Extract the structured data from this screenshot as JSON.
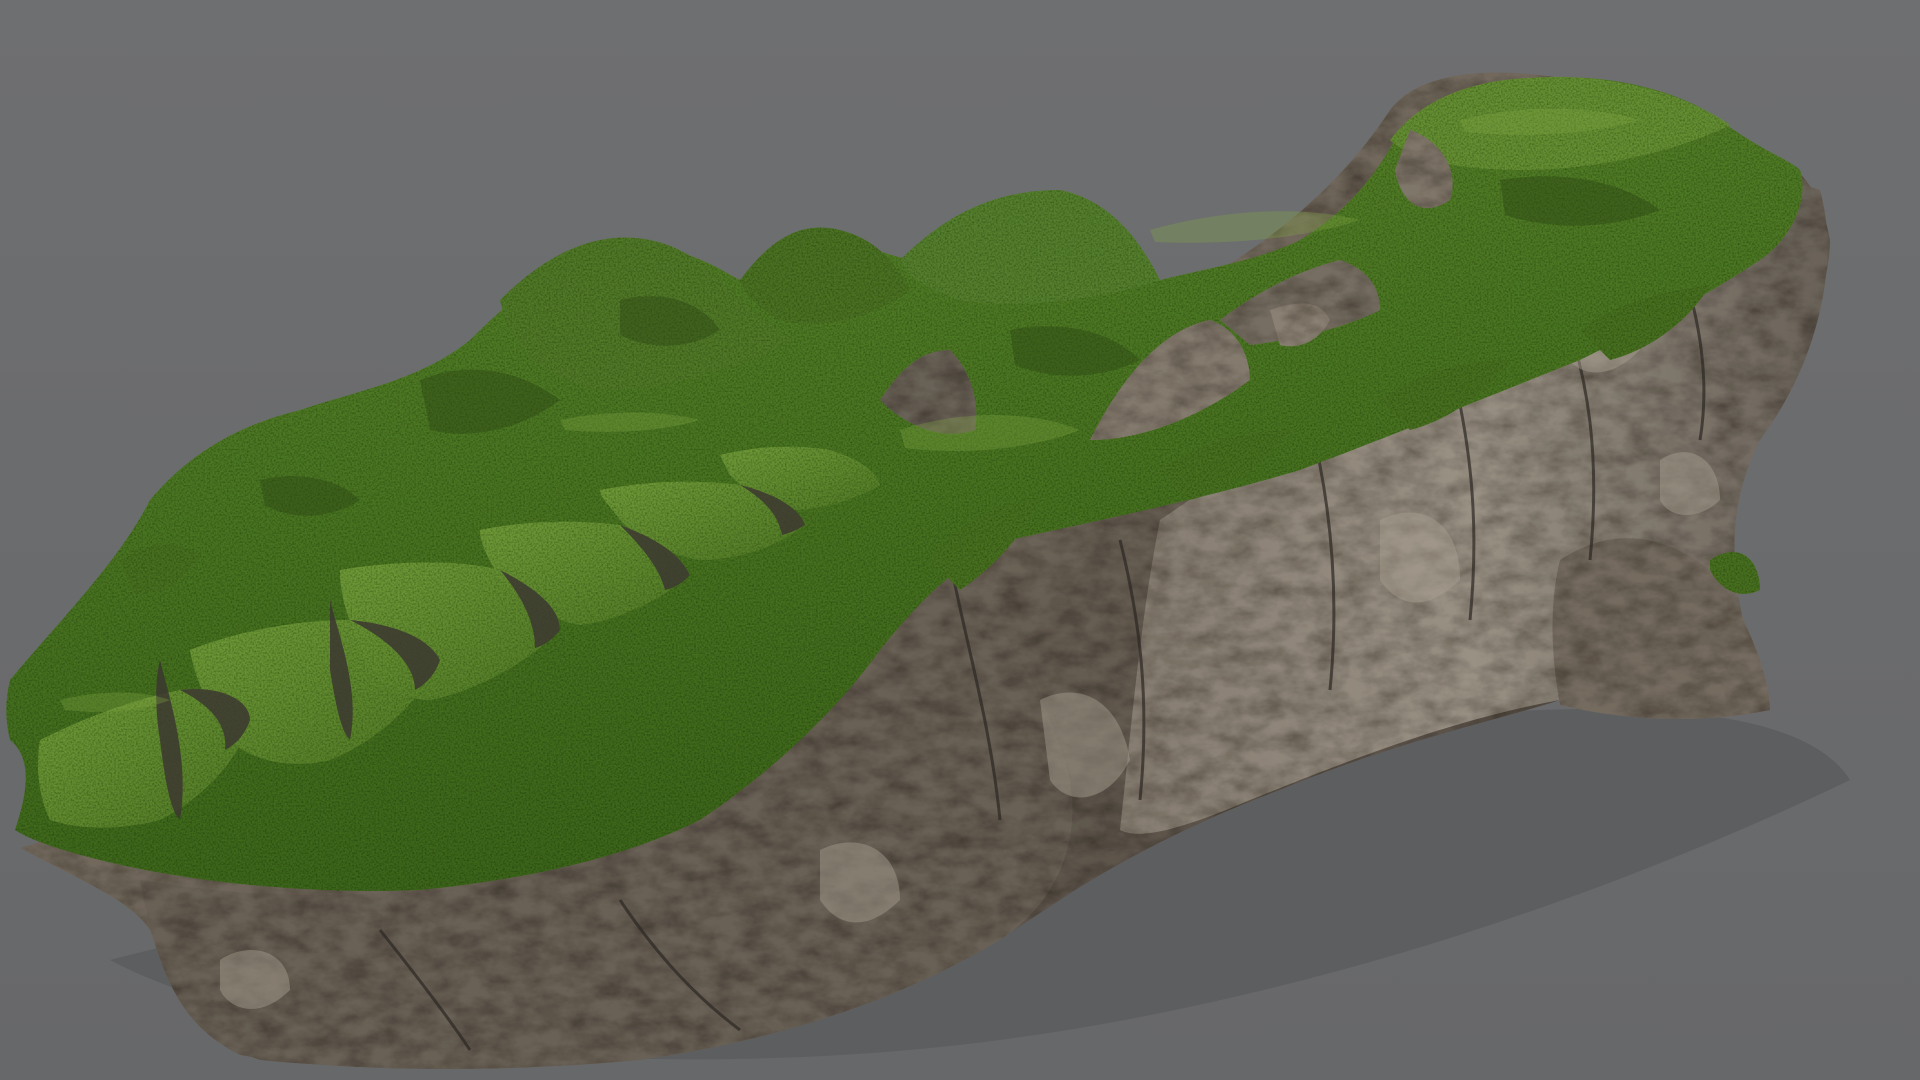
{
  "scene": {
    "subject": "moss-covered-rock-cliff-3d-model",
    "colors": {
      "background": "#707173",
      "shadow": "#5e5f61",
      "rock_light": "#9a8f82",
      "rock_mid": "#6f665c",
      "rock_dark": "#3d3832",
      "moss_light": "#6f9a3a",
      "moss_mid": "#4e7a26",
      "moss_dark": "#2f4f18",
      "moss_brown": "#5a5230"
    }
  }
}
